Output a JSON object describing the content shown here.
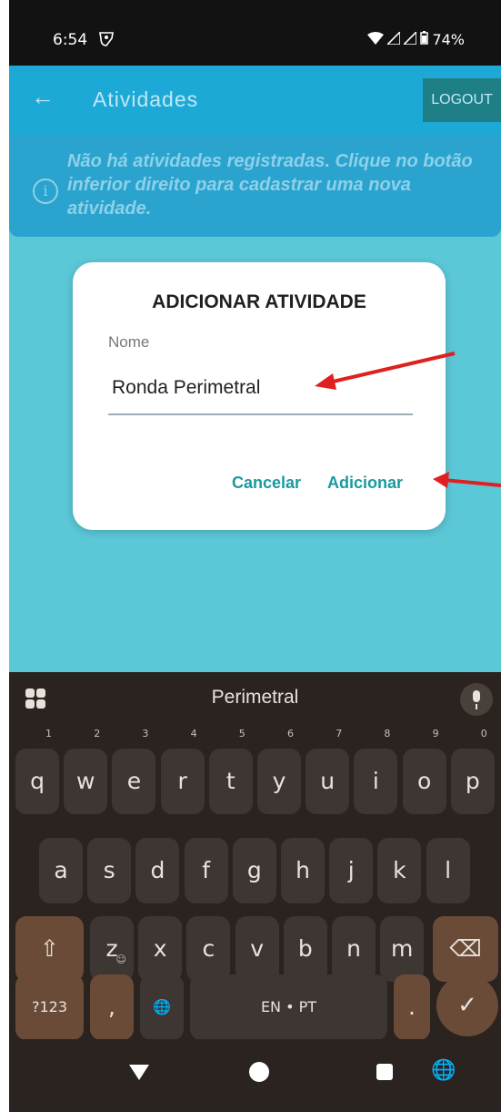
{
  "status_bar": {
    "time": "6:54",
    "vpn_icon": "vpn-key-icon",
    "battery": "74%"
  },
  "app_bar": {
    "back_icon": "arrow-back-icon",
    "title": "Atividades",
    "logout_label": "LOGOUT"
  },
  "info_banner": {
    "icon": "info-circle-icon",
    "message": "Não há atividades registradas. Clique no botão inferior direito para cadastrar uma nova atividade."
  },
  "dialog": {
    "title": "ADICIONAR ATIVIDADE",
    "field_label": "Nome",
    "field_value": "Ronda Perimetral",
    "cancel_label": "Cancelar",
    "add_label": "Adicionar"
  },
  "keyboard": {
    "suggestion": "Perimetral",
    "row1": [
      {
        "key": "q",
        "num": "1"
      },
      {
        "key": "w",
        "num": "2"
      },
      {
        "key": "e",
        "num": "3"
      },
      {
        "key": "r",
        "num": "4"
      },
      {
        "key": "t",
        "num": "5"
      },
      {
        "key": "y",
        "num": "6"
      },
      {
        "key": "u",
        "num": "7"
      },
      {
        "key": "i",
        "num": "8"
      },
      {
        "key": "o",
        "num": "9"
      },
      {
        "key": "p",
        "num": "0"
      }
    ],
    "row2": [
      "a",
      "s",
      "d",
      "f",
      "g",
      "h",
      "j",
      "k",
      "l"
    ],
    "row3": [
      "z",
      "x",
      "c",
      "v",
      "b",
      "n",
      "m"
    ],
    "symbols_label": "?123",
    "emoji_glyph": "☺",
    "comma": ",",
    "space_label": "EN • PT",
    "period": ".",
    "shift_glyph": "⇧",
    "backspace_glyph": "⌫",
    "globe_glyph": "🌐",
    "enter_glyph": "✓"
  },
  "annotation_color": "#e02020",
  "colors": {
    "app_bar": "#1da9d6",
    "background": "#5bc8d8",
    "accent": "#1a9a9e",
    "keyboard": "#2a2320"
  }
}
